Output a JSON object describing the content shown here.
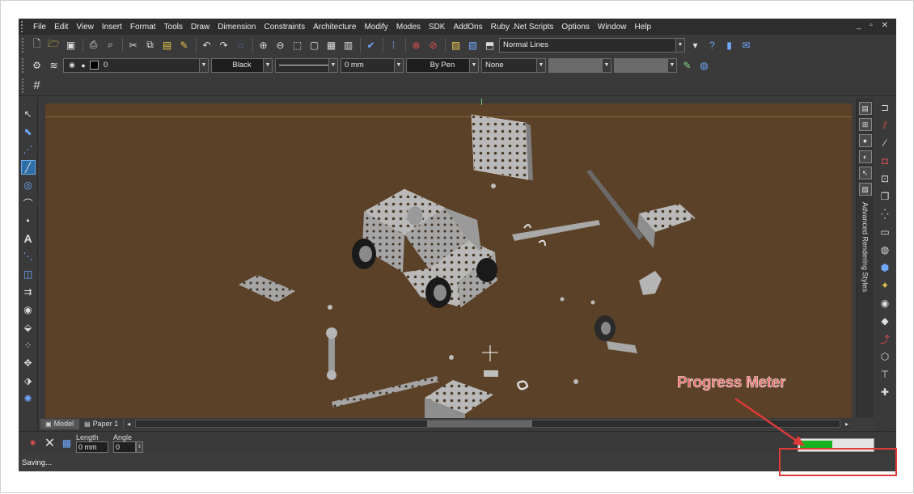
{
  "menu": {
    "items": [
      "File",
      "Edit",
      "View",
      "Insert",
      "Format",
      "Tools",
      "Draw",
      "Dimension",
      "Constraints",
      "Architecture",
      "Modify",
      "Modes",
      "SDK",
      "AddOns",
      "Ruby .Net Scripts",
      "Options",
      "Window",
      "Help"
    ],
    "window_controls": "_ ▫ ✕"
  },
  "toolbar1": {
    "line_style": "Normal Lines"
  },
  "toolbar2": {
    "layer": "0",
    "color": "Black",
    "thickness": "0 mm",
    "print_style": "By Pen",
    "hatch": "None"
  },
  "tabs": {
    "model": "Model",
    "paper": "Paper 1"
  },
  "right_panel": {
    "title": "Advanced Rendering Styles"
  },
  "command": {
    "length_label": "Length",
    "length_value": "0 mm",
    "angle_label": "Angle",
    "angle_value": "0"
  },
  "status": {
    "text": "Saving...",
    "progress": 0.45
  },
  "annotation": {
    "label": "Progress Meter"
  },
  "colors": {
    "viewport_bg": "#5a4127",
    "progress_fill": "#16b31f",
    "annotation": "#e03a3a"
  }
}
